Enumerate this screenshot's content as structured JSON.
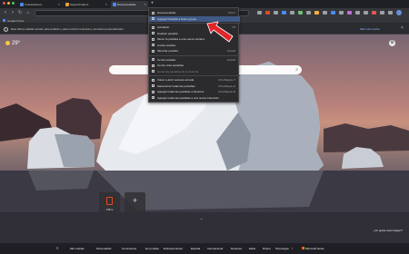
{
  "browser": {
    "tabs": [
      {
        "title": "Cololavitavera",
        "active": false
      },
      {
        "title": "Supportmakers",
        "active": false
      },
      {
        "title": "Nueva pestaña",
        "active": true
      }
    ],
    "bookmark": "Google Fotos",
    "accent_colors": {
      "close": "#e8545a",
      "min": "#f5b23b",
      "max": "#49c358"
    }
  },
  "infobar": {
    "text": "Esta última calidad cuando para análisis y para mostrar contenido y anuncios personalizados",
    "link": "Más información"
  },
  "newtab": {
    "weather": "29°",
    "tiles": [
      {
        "label": "Office",
        "icon": "office-icon"
      },
      {
        "label": "",
        "icon": "plus-icon"
      }
    ],
    "image_credit": "¿Te gusta esta imagen?",
    "nav": {
      "items": [
        "Mis noticias",
        "Personalizar",
        "Coronavirus",
        "En portada",
        "Entretenimiento",
        "España",
        "Internacional",
        "Deportes",
        "Estilo",
        "Dinero",
        "Tecnología"
      ],
      "powered_by": "Microsoft News"
    }
  },
  "tab_menu": {
    "items": [
      {
        "label": "Nueva pestaña",
        "shortcut": "Ctrl+T",
        "highlight": false,
        "disabled": false
      },
      {
        "label": "Agregar Pestaña a Nuevo grupo",
        "shortcut": "",
        "highlight": true,
        "disabled": false
      },
      {
        "sep": true
      },
      {
        "label": "Actualizar",
        "shortcut": "F5",
        "highlight": false,
        "disabled": false
      },
      {
        "label": "Duplicar pestaña",
        "shortcut": "",
        "highlight": false,
        "disabled": false
      },
      {
        "label": "Mover la pestaña a una nueva ventana",
        "shortcut": "",
        "highlight": false,
        "disabled": false
      },
      {
        "label": "Anclar pestaña",
        "shortcut": "",
        "highlight": false,
        "disabled": false
      },
      {
        "label": "Silenciar pestaña",
        "shortcut": "Ctrl+M",
        "highlight": false,
        "disabled": false
      },
      {
        "sep": true
      },
      {
        "label": "Cerrar pestaña",
        "shortcut": "Ctrl+W",
        "highlight": false,
        "disabled": false
      },
      {
        "label": "Cerrar otras pestañas",
        "shortcut": "",
        "highlight": false,
        "disabled": false
      },
      {
        "label": "Cerrar las pestañas de la derecha",
        "shortcut": "",
        "highlight": false,
        "disabled": true
      },
      {
        "sep": true
      },
      {
        "label": "Volver a abrir ventana cerrada",
        "shortcut": "Ctrl+Mayús+T",
        "highlight": false,
        "disabled": false
      },
      {
        "label": "Seleccionar todas las pestañas",
        "shortcut": "Ctrl+Mayús+A",
        "highlight": false,
        "disabled": false
      },
      {
        "label": "Agregar todas las pestañas a favoritos",
        "shortcut": "Ctrl+Mayús+D",
        "highlight": false,
        "disabled": false
      },
      {
        "label": "Agregar todas las pestañas a una nueva Colección",
        "shortcut": "",
        "highlight": false,
        "disabled": false
      }
    ]
  }
}
